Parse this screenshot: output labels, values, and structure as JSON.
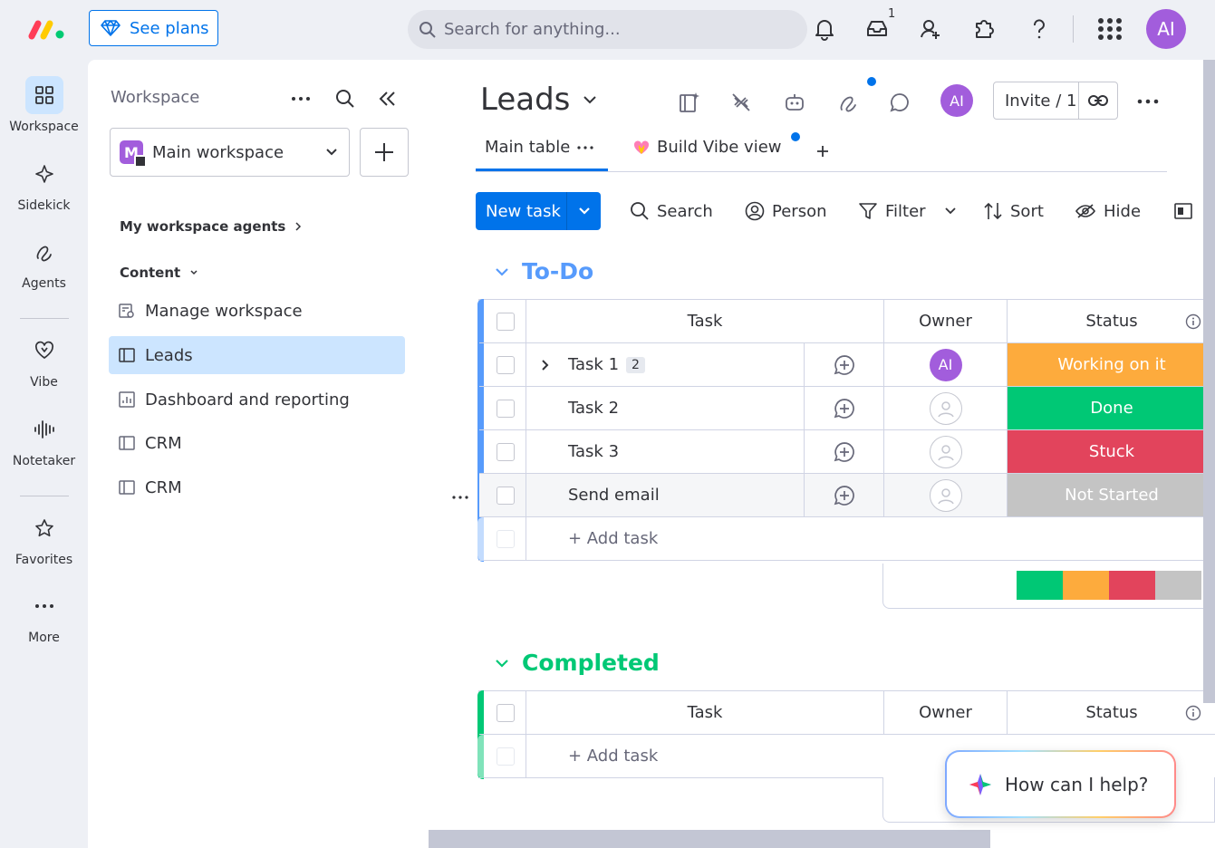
{
  "topbar": {
    "see_plans": "See plans",
    "search_placeholder": "Search for anything...",
    "inbox_badge": "1",
    "user_initials": "AI"
  },
  "leftnav": {
    "items": [
      {
        "label": "Workspace",
        "icon": "workspace-grid-icon"
      },
      {
        "label": "Sidekick",
        "icon": "sparkle-icon"
      },
      {
        "label": "Agents",
        "icon": "agents-icon"
      },
      {
        "label": "Vibe",
        "icon": "heart-icon"
      },
      {
        "label": "Notetaker",
        "icon": "waveform-icon"
      },
      {
        "label": "Favorites",
        "icon": "star-icon"
      },
      {
        "label": "More",
        "icon": "more-dots-icon"
      }
    ]
  },
  "sidepanel": {
    "title": "Workspace",
    "workspace_name": "Main workspace",
    "workspace_initial": "M",
    "agents_link": "My workspace agents",
    "content_label": "Content",
    "items": [
      {
        "label": "Manage workspace"
      },
      {
        "label": "Leads"
      },
      {
        "label": "Dashboard and reporting"
      },
      {
        "label": "CRM"
      },
      {
        "label": "CRM"
      }
    ]
  },
  "board": {
    "title": "Leads",
    "user_initials": "AI",
    "invite_label": "Invite / 1",
    "tabs": [
      {
        "label": "Main table"
      },
      {
        "label": "Build Vibe view"
      }
    ],
    "toolbar": {
      "new_task": "New task",
      "search": "Search",
      "person": "Person",
      "filter": "Filter",
      "sort": "Sort",
      "hide": "Hide"
    }
  },
  "groups": {
    "todo": {
      "title": "To-Do",
      "color": "#579bfc",
      "columns": {
        "task": "Task",
        "owner": "Owner",
        "status": "Status"
      },
      "rows": [
        {
          "task": "Task 1",
          "subitems": "2",
          "owner": "AI",
          "status": "Working on it",
          "status_color": "#fdab3d"
        },
        {
          "task": "Task 2",
          "owner": "",
          "status": "Done",
          "status_color": "#00c875"
        },
        {
          "task": "Task 3",
          "owner": "",
          "status": "Stuck",
          "status_color": "#e2445c"
        },
        {
          "task": "Send email",
          "owner": "",
          "status": "Not Started",
          "status_color": "#c4c4c4"
        }
      ],
      "add_label": "+ Add task"
    },
    "completed": {
      "title": "Completed",
      "color": "#00c875",
      "columns": {
        "task": "Task",
        "owner": "Owner",
        "status": "Status"
      },
      "add_label": "+ Add task"
    }
  },
  "help": {
    "label": "How can I help?"
  }
}
